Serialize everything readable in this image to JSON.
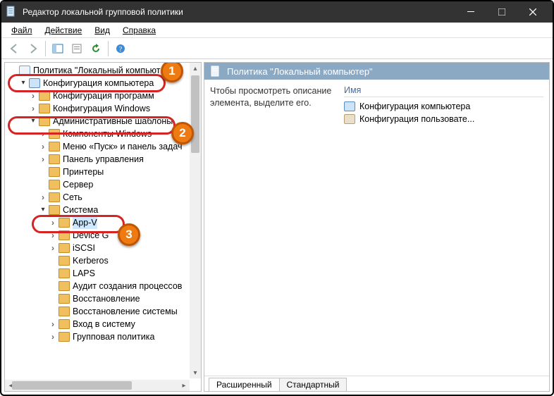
{
  "window": {
    "title": "Редактор локальной групповой политики"
  },
  "menu": {
    "file": "Файл",
    "action": "Действие",
    "view": "Вид",
    "help": "Справка"
  },
  "tree": {
    "root": "Политика \"Локальный компьют",
    "computer_config": "Конфигурация компьютера",
    "software_settings": "Конфигурация программ",
    "windows_config": "Конфигурация Windows",
    "admin_templates": "Административные шаблоны",
    "windows_components": "Компоненты Windows",
    "start_menu": "Меню «Пуск» и панель задач",
    "control_panel": "Панель управления",
    "printers": "Принтеры",
    "server": "Сервер",
    "network": "Сеть",
    "system": "Система",
    "app_v": "App-V",
    "device_c": "Device G",
    "iscsi": "iSCSI",
    "kerberos": "Kerberos",
    "laps": "LAPS",
    "process_audit": "Аудит создания процессов",
    "recovery": "Восстановление",
    "system_recovery": "Восстановление системы",
    "logon": "Вход в систему",
    "group_policy": "Групповая политика"
  },
  "right": {
    "title": "Политика \"Локальный компьютер\"",
    "desc": "Чтобы просмотреть описание элемента, выделите его.",
    "col_name": "Имя",
    "item1": "Конфигурация компьютера",
    "item2": "Конфигурация пользовате..."
  },
  "tabs": {
    "extended": "Расширенный",
    "standard": "Стандартный"
  },
  "callouts": {
    "c1": "1",
    "c2": "2",
    "c3": "3"
  }
}
